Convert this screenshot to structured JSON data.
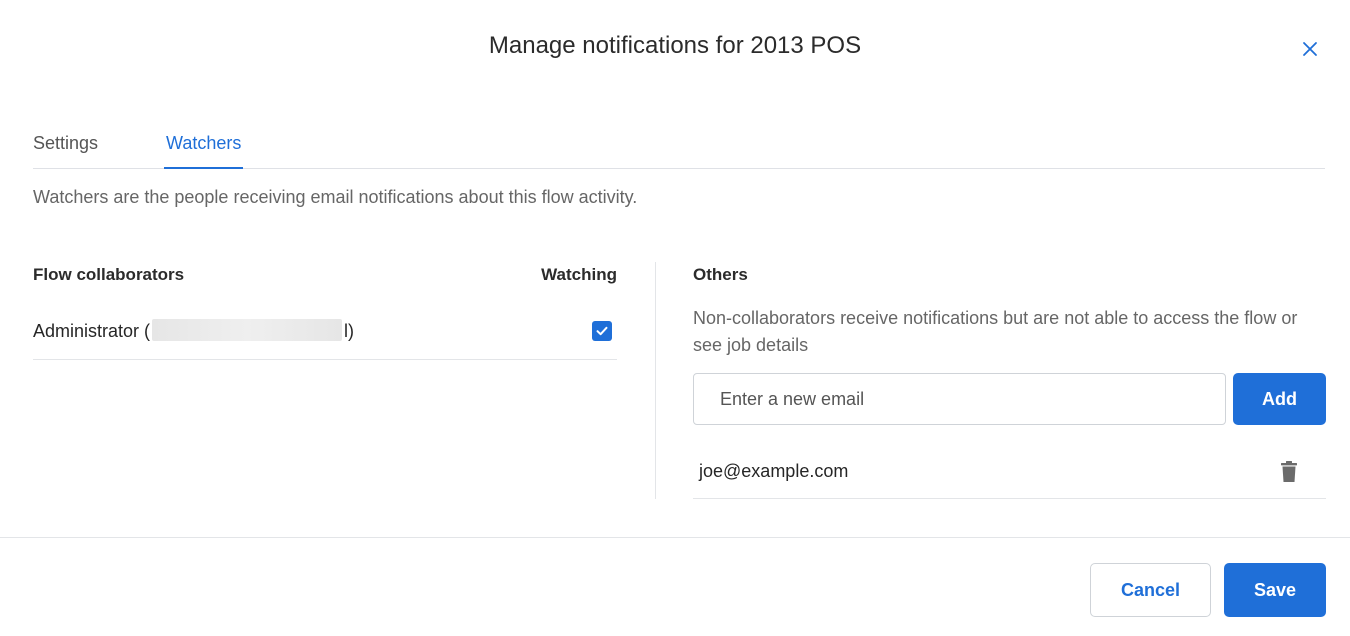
{
  "dialog": {
    "title": "Manage notifications for 2013 POS",
    "close_icon": "close-icon"
  },
  "tabs": [
    {
      "label": "Settings",
      "active": false
    },
    {
      "label": "Watchers",
      "active": true
    }
  ],
  "intro": "Watchers are the people receiving email notifications about this flow activity.",
  "collaborators": {
    "header": "Flow collaborators",
    "watching_header": "Watching",
    "rows": [
      {
        "name_prefix": "Administrator (",
        "name_suffix": "l)",
        "watching": true
      }
    ]
  },
  "others": {
    "title": "Others",
    "description": "Non-collaborators receive notifications but are not able to access the flow or see job details",
    "input_placeholder": "Enter a new email",
    "add_label": "Add",
    "emails": [
      {
        "email": "joe@example.com",
        "icon": "trash-icon"
      }
    ]
  },
  "footer": {
    "cancel_label": "Cancel",
    "save_label": "Save"
  },
  "colors": {
    "accent": "#1f6fd8",
    "divider": "#e3e5e8"
  }
}
